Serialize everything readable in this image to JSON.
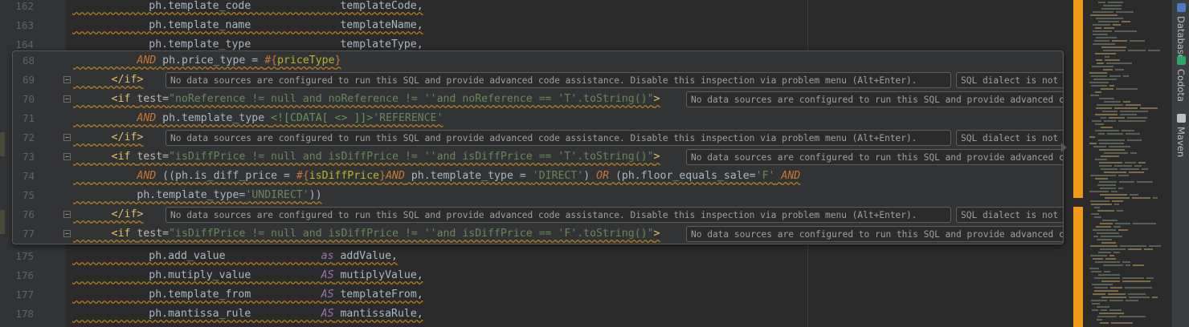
{
  "background_lines": [
    {
      "ln": "162",
      "parts": [
        {
          "t": "            ph.template_code              templateCode,",
          "c": "var"
        }
      ]
    },
    {
      "ln": "163",
      "parts": [
        {
          "t": "            ph.template_name              templateName,",
          "c": "var"
        }
      ]
    },
    {
      "ln": "164",
      "parts": [
        {
          "t": "            ph.template_type              templateType,",
          "c": "var"
        }
      ]
    },
    {
      "ln": "175",
      "parts": [
        {
          "t": "            ph.add_value               ",
          "c": "var"
        },
        {
          "t": "as",
          "c": "alias"
        },
        {
          "t": " addValue,",
          "c": "var"
        }
      ]
    },
    {
      "ln": "176",
      "parts": [
        {
          "t": "            ph.mutiply_value           ",
          "c": "var"
        },
        {
          "t": "AS",
          "c": "alias"
        },
        {
          "t": " mutiplyValue,",
          "c": "var"
        }
      ]
    },
    {
      "ln": "177",
      "parts": [
        {
          "t": "            ph.template_from           ",
          "c": "var"
        },
        {
          "t": "AS",
          "c": "alias"
        },
        {
          "t": " templateFrom,",
          "c": "var"
        }
      ]
    },
    {
      "ln": "178",
      "parts": [
        {
          "t": "            ph.mantissa_rule           ",
          "c": "var"
        },
        {
          "t": "AS",
          "c": "alias"
        },
        {
          "t": " mantissaRule,",
          "c": "var"
        }
      ]
    }
  ],
  "peek_lines": [
    {
      "ln": "68",
      "parts": [
        {
          "t": "          AND",
          "c": "kw"
        },
        {
          "t": " ph.price_type = ",
          "c": "var"
        },
        {
          "t": "#{",
          "c": "interp"
        },
        {
          "t": "priceType",
          "c": "pname"
        },
        {
          "t": "}",
          "c": "interp"
        }
      ],
      "fold": false,
      "hints": []
    },
    {
      "ln": "69",
      "parts": [
        {
          "t": "      </if>",
          "c": "tag"
        }
      ],
      "fold": true,
      "hints": [
        "No data sources are configured to run this SQL and provide advanced code assistance. Disable this inspection via problem menu (Alt+Enter).",
        "SQL dialect is not configured"
      ]
    },
    {
      "ln": "70",
      "parts": [
        {
          "t": "      <if ",
          "c": "tag"
        },
        {
          "t": "test=",
          "c": "attr"
        },
        {
          "t": "\"noReference != null and noReference != ''and noReference == 'T'.toString()\"",
          "c": "str"
        },
        {
          "t": ">",
          "c": "tag"
        }
      ],
      "fold": true,
      "hints": [
        "No data sources are configured to run this SQL and provide advanced code assistance."
      ]
    },
    {
      "ln": "71",
      "parts": [
        {
          "t": "          AND",
          "c": "kw"
        },
        {
          "t": " ph.template_type ",
          "c": "var"
        },
        {
          "t": "<![CDATA[ <> ]]>",
          "c": "cdata"
        },
        {
          "t": "'REFERENCE'",
          "c": "str"
        }
      ],
      "fold": false,
      "hints": []
    },
    {
      "ln": "72",
      "parts": [
        {
          "t": "      </if>",
          "c": "tag"
        }
      ],
      "fold": true,
      "hints": [
        "No data sources are configured to run this SQL and provide advanced code assistance. Disable this inspection via problem menu (Alt+Enter).",
        "SQL dialect is not configured"
      ]
    },
    {
      "ln": "73",
      "parts": [
        {
          "t": "      <if ",
          "c": "tag"
        },
        {
          "t": "test=",
          "c": "attr"
        },
        {
          "t": "\"isDiffPrice != null and isDiffPrice != ''and isDiffPrice == 'T'.toString()\"",
          "c": "str"
        },
        {
          "t": ">",
          "c": "tag"
        }
      ],
      "fold": true,
      "hints": [
        "No data sources are configured to run this SQL and provide advanced code assistance."
      ]
    },
    {
      "ln": "74",
      "parts": [
        {
          "t": "          AND",
          "c": "kw"
        },
        {
          "t": " ((ph.is_diff_price = ",
          "c": "var"
        },
        {
          "t": "#{",
          "c": "interp"
        },
        {
          "t": "isDiffPrice",
          "c": "pname"
        },
        {
          "t": "}",
          "c": "interp"
        },
        {
          "t": "AND",
          "c": "kw"
        },
        {
          "t": " ph.template_type = ",
          "c": "var"
        },
        {
          "t": "'DIRECT'",
          "c": "str"
        },
        {
          "t": ") ",
          "c": "var"
        },
        {
          "t": "OR",
          "c": "kw"
        },
        {
          "t": " (ph.floor_equals_sale=",
          "c": "var"
        },
        {
          "t": "'F'",
          "c": "str"
        },
        {
          "t": " ",
          "c": "var"
        },
        {
          "t": "AND",
          "c": "kw"
        }
      ],
      "fold": false,
      "hints": []
    },
    {
      "ln": "75",
      "parts": [
        {
          "t": "          ph.template_type=",
          "c": "var"
        },
        {
          "t": "'UNDIRECT'",
          "c": "str"
        },
        {
          "t": "))",
          "c": "var"
        }
      ],
      "fold": false,
      "hints": []
    },
    {
      "ln": "76",
      "parts": [
        {
          "t": "      </if>",
          "c": "tag"
        }
      ],
      "fold": true,
      "hints": [
        "No data sources are configured to run this SQL and provide advanced code assistance. Disable this inspection via problem menu (Alt+Enter).",
        "SQL dialect is not configured"
      ]
    },
    {
      "ln": "77",
      "parts": [
        {
          "t": "      <if ",
          "c": "tag"
        },
        {
          "t": "test=",
          "c": "attr"
        },
        {
          "t": "\"isDiffPrice != null and isDiffPrice != ''and isDiffPrice == 'F'.toString()\"",
          "c": "str"
        },
        {
          "t": ">",
          "c": "tag"
        }
      ],
      "fold": true,
      "hints": [
        "No data sources are configured to run this SQL and provide advanced code assistance."
      ]
    }
  ],
  "sidebar": {
    "tabs": [
      {
        "label": "Database",
        "icon": "database-icon"
      },
      {
        "label": "Codota",
        "icon": "codota-icon"
      },
      {
        "label": "Maven",
        "icon": "maven-icon"
      }
    ]
  },
  "colors": {
    "accent_scroll": "#f09b1a",
    "background": "#2b2b2b"
  }
}
